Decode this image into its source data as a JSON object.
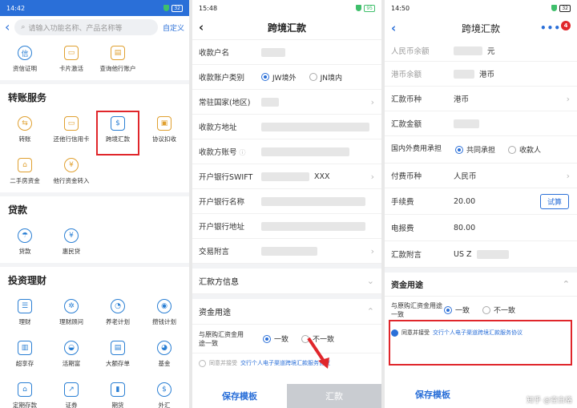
{
  "panel1": {
    "status_time": "14:42",
    "battery": "32",
    "search_placeholder": "请输入功能名称、产品名称等",
    "custom_label": "自定义",
    "top_items": [
      {
        "label": "资信证明",
        "icon": "certificate-icon"
      },
      {
        "label": "卡片激活",
        "icon": "card-icon"
      },
      {
        "label": "查询他行账户",
        "icon": "account-icon"
      }
    ],
    "transfer": {
      "title": "转账服务",
      "items": [
        {
          "label": "转账",
          "icon": "transfer-icon"
        },
        {
          "label": "还他行信用卡",
          "icon": "credit-card-icon"
        },
        {
          "label": "跨境汇款",
          "icon": "cross-border-icon"
        },
        {
          "label": "协议扣收",
          "icon": "agreement-icon"
        },
        {
          "label": "二手房资金",
          "icon": "house-icon"
        },
        {
          "label": "他行资金转入",
          "icon": "fund-in-icon"
        }
      ]
    },
    "loan": {
      "title": "贷款",
      "items": [
        {
          "label": "贷款",
          "icon": "loan-icon"
        },
        {
          "label": "惠民贷",
          "icon": "huimin-icon"
        }
      ]
    },
    "invest": {
      "title": "投资理财",
      "items": [
        {
          "label": "理财",
          "icon": "finance-icon"
        },
        {
          "label": "理财顾问",
          "icon": "advisor-icon"
        },
        {
          "label": "养老计划",
          "icon": "pension-icon"
        },
        {
          "label": "攒钱计划",
          "icon": "piggy-icon"
        },
        {
          "label": "超享存",
          "icon": "deposit-icon"
        },
        {
          "label": "活期富",
          "icon": "current-icon"
        },
        {
          "label": "大额存单",
          "icon": "cd-icon"
        },
        {
          "label": "基金",
          "icon": "fund-icon"
        },
        {
          "label": "定期存款",
          "icon": "fixed-icon"
        },
        {
          "label": "证券",
          "icon": "stock-icon"
        },
        {
          "label": "期货",
          "icon": "futures-icon"
        },
        {
          "label": "外汇",
          "icon": "forex-icon"
        }
      ]
    }
  },
  "panel2": {
    "status_time": "15:48",
    "battery": "95",
    "title": "跨境汇款",
    "rows": {
      "payee_name": "收款户名",
      "account_type": "收款账户类别",
      "opt_jw": "JW境外",
      "opt_jn": "JN境内",
      "country": "常驻国家(地区)",
      "address": "收款方地址",
      "account_no": "收款方账号",
      "swift": "开户银行SWIFT",
      "swift_val": "XXX",
      "bank_name": "开户银行名称",
      "bank_addr": "开户银行地址",
      "postscript": "交易附言"
    },
    "sec_remitter": "汇款方信息",
    "sec_purpose": "资金用途",
    "purpose_label": "与原购汇资金用途一致",
    "opt_same": "一致",
    "opt_diff": "不一致",
    "agree_prefix": "同意并接受",
    "agree_link": "交行个人电子渠道跨境汇款服务协议",
    "save": "保存模板",
    "remit": "汇款"
  },
  "panel3": {
    "status_time": "14:50",
    "battery": "32",
    "title": "跨境汇款",
    "badge": "4",
    "rows": {
      "rmb_balance": "人民币余额",
      "rmb_unit": "元",
      "hkd_balance": "港币余额",
      "hkd_unit": "港币",
      "currency": "汇款币种",
      "currency_val": "港币",
      "amount": "汇款金额",
      "fee_bearer": "国内外费用承担",
      "opt_shared": "共同承担",
      "opt_payee": "收款人",
      "fee_currency": "付费币种",
      "fee_currency_val": "人民币",
      "fee": "手续费",
      "fee_val": "20.00",
      "calc": "试算",
      "telegraph": "电报费",
      "telegraph_val": "80.00",
      "postscript": "汇款附言",
      "postscript_val": "US Z"
    },
    "sec_purpose": "资金用途",
    "purpose_label": "与原购汇资金用途一致",
    "opt_same": "一致",
    "opt_diff": "不一致",
    "agree_prefix": "同意并接受",
    "agree_link": "交行个人电子渠道跨境汇款服务协议",
    "save": "保存模板",
    "watermark": "知乎 @空白格"
  }
}
